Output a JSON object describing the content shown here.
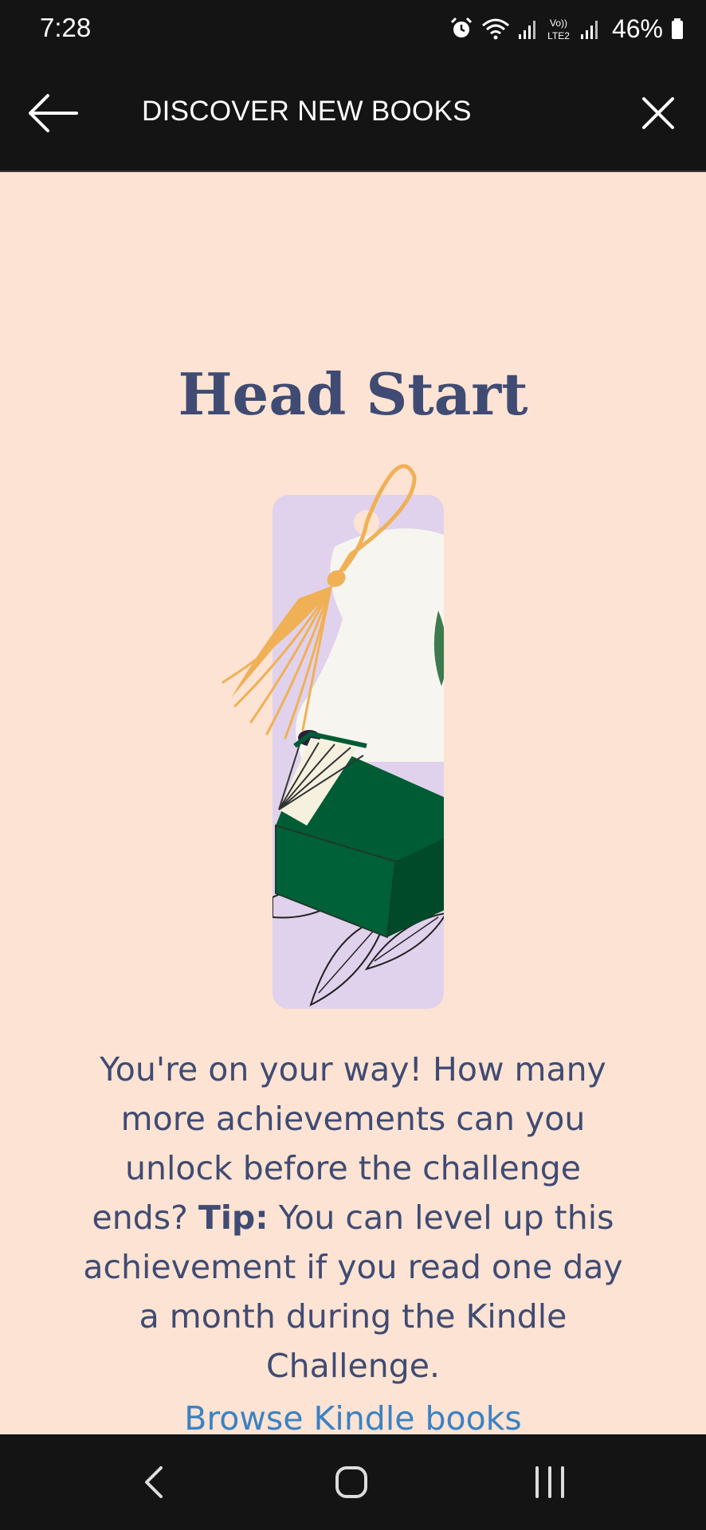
{
  "status": {
    "time": "7:28",
    "battery": "46%",
    "icons": [
      "alarm-icon",
      "wifi-icon",
      "signal-icon",
      "volte-icon",
      "signal-icon",
      "battery-icon"
    ]
  },
  "header": {
    "title": "DISCOVER NEW BOOKS",
    "back_icon": "arrow-left-icon",
    "close_icon": "close-icon"
  },
  "achievement": {
    "title": "Head Start",
    "illustration": "bookmark-with-tassel-and-book",
    "description_intro": "You're on your way! How many more achievements can you unlock before the challenge ends?",
    "tip_label": "Tip:",
    "tip_text": "You can level up this achievement if you read one day a month during the Kindle Challenge.",
    "link": "Browse Kindle books"
  },
  "navigation": {
    "back_icon": "nav-back-icon",
    "home_icon": "nav-home-icon",
    "recents_icon": "nav-recents-icon"
  },
  "colors": {
    "background": "#fde3d3",
    "bars": "#141414",
    "text": "#3f4b73",
    "link": "#3a82c4",
    "bookmark": "#e0d2ec",
    "book": "#005c34",
    "tassel": "#f0b055"
  }
}
